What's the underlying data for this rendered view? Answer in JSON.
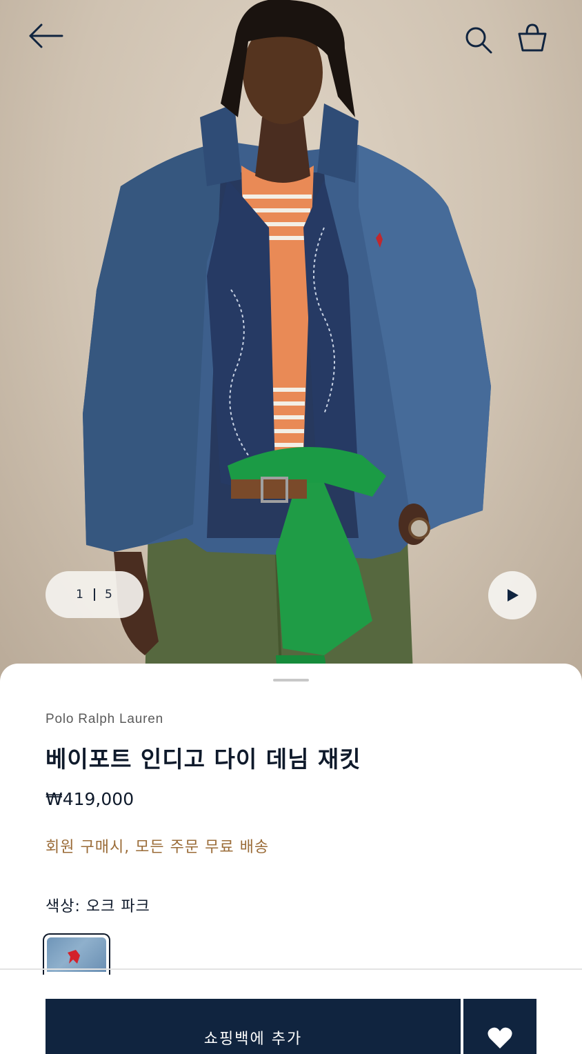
{
  "hero": {
    "pager": {
      "current": "1",
      "total": "5"
    }
  },
  "icons": {
    "back": "arrow-left-icon",
    "search": "search-icon",
    "bag": "shopping-bag-icon",
    "play": "play-icon",
    "wishlist": "heart-icon"
  },
  "product": {
    "brand": "Polo Ralph Lauren",
    "title": "베이포트 인디고 다이 데님 재킷",
    "price": "₩419,000",
    "promo": "회원 구매시, 모든 주문 무료 배송",
    "color_label": "색상: 오크 파크"
  },
  "actions": {
    "add_to_bag_label": "쇼핑백에 추가"
  },
  "colors": {
    "navy": "#10243f",
    "promo": "#9a6b37",
    "background": "#ffffff"
  }
}
